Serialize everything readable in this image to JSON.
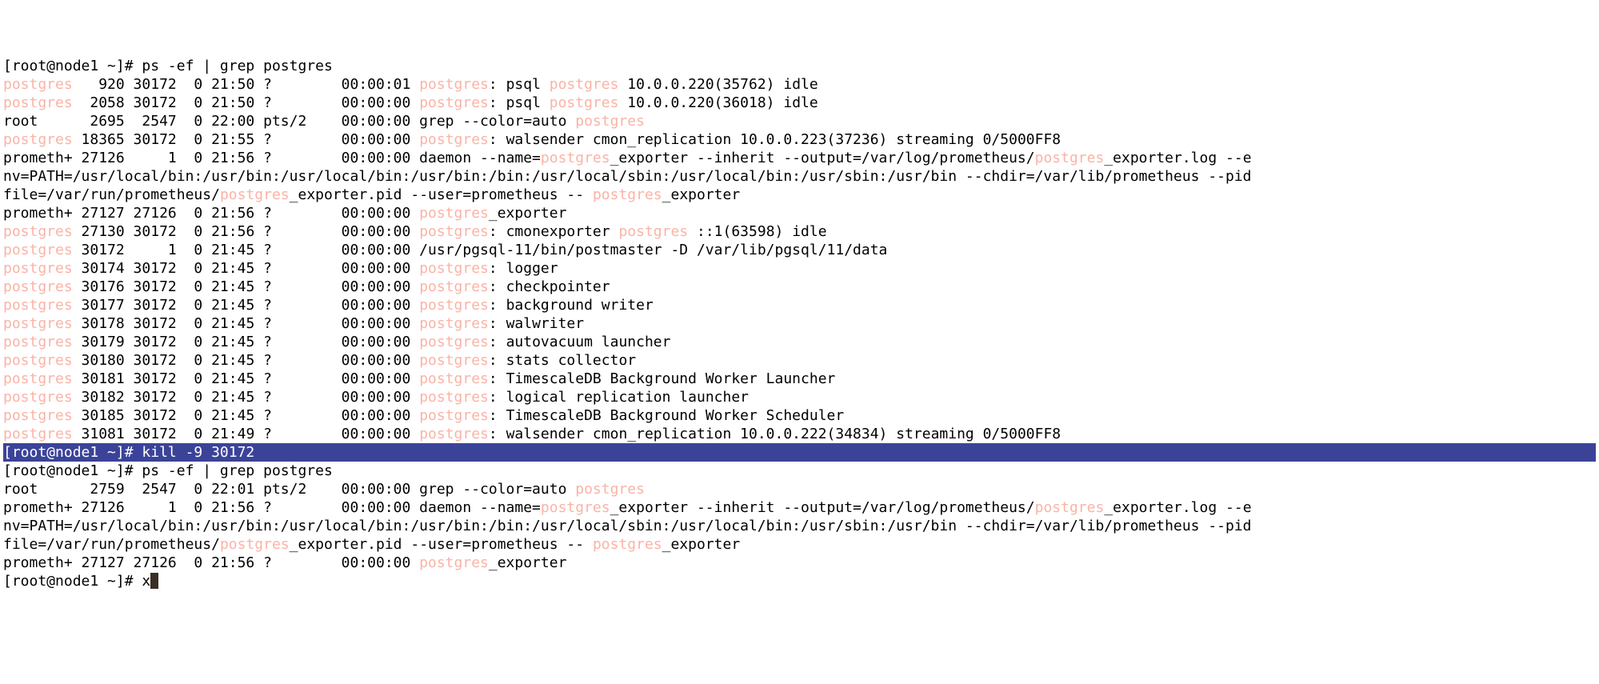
{
  "prompt1_prefix": "[root@node1 ~]# ",
  "cmd1": "ps -ef | grep postgres",
  "rows1": [
    {
      "user": "postgres",
      "hl_user": true,
      "pid": "  920",
      "ppid": "30172",
      "c": "0",
      "stime": "21:50",
      "tty": "?    ",
      "time": "00:00:01",
      "cmd": [
        {
          "t": "postgres",
          "hl": true
        },
        {
          "t": ": psql "
        },
        {
          "t": "postgres",
          "hl": true
        },
        {
          "t": " 10.0.0.220(35762) idle"
        }
      ]
    },
    {
      "user": "postgres",
      "hl_user": true,
      "pid": " 2058",
      "ppid": "30172",
      "c": "0",
      "stime": "21:50",
      "tty": "?    ",
      "time": "00:00:00",
      "cmd": [
        {
          "t": "postgres",
          "hl": true
        },
        {
          "t": ": psql "
        },
        {
          "t": "postgres",
          "hl": true
        },
        {
          "t": " 10.0.0.220(36018) idle"
        }
      ]
    },
    {
      "user": "root    ",
      "hl_user": false,
      "pid": " 2695",
      "ppid": " 2547",
      "c": "0",
      "stime": "22:00",
      "tty": "pts/2",
      "time": "00:00:00",
      "cmd": [
        {
          "t": "grep --color=auto "
        },
        {
          "t": "postgres",
          "hl": true
        }
      ]
    },
    {
      "user": "postgres",
      "hl_user": true,
      "pid": "18365",
      "ppid": "30172",
      "c": "0",
      "stime": "21:55",
      "tty": "?    ",
      "time": "00:00:00",
      "cmd": [
        {
          "t": "postgres",
          "hl": true
        },
        {
          "t": ": walsender cmon_replication 10.0.0.223(37236) streaming 0/5000FF8"
        }
      ]
    }
  ],
  "daemon_line1_pre": "prometh+ 27126     1  0 21:56 ?        00:00:00 daemon --name=",
  "daemon_hl1": "postgres",
  "daemon_line1_mid": "_exporter --inherit --output=/var/log/prometheus/",
  "daemon_hl2": "postgres",
  "daemon_line1_post": "_exporter.log --e",
  "daemon_line2": "nv=PATH=/usr/local/bin:/usr/bin:/usr/local/bin:/usr/bin:/bin:/usr/local/sbin:/usr/local/bin:/usr/sbin:/usr/bin --chdir=/var/lib/prometheus --pid",
  "daemon_line3_pre": "file=/var/run/prometheus/",
  "daemon_hl3": "postgres",
  "daemon_line3_mid": "_exporter.pid --user=prometheus -- ",
  "daemon_hl4": "postgres",
  "daemon_line3_post": "_exporter",
  "rows1b": [
    {
      "user": "prometh+",
      "hl_user": false,
      "pid": "27127",
      "ppid": "27126",
      "c": "0",
      "stime": "21:56",
      "tty": "?    ",
      "time": "00:00:00",
      "cmd": [
        {
          "t": "postgres",
          "hl": true
        },
        {
          "t": "_exporter"
        }
      ]
    },
    {
      "user": "postgres",
      "hl_user": true,
      "pid": "27130",
      "ppid": "30172",
      "c": "0",
      "stime": "21:56",
      "tty": "?    ",
      "time": "00:00:00",
      "cmd": [
        {
          "t": "postgres",
          "hl": true
        },
        {
          "t": ": cmonexporter "
        },
        {
          "t": "postgres",
          "hl": true
        },
        {
          "t": " ::1(63598) idle"
        }
      ]
    },
    {
      "user": "postgres",
      "hl_user": true,
      "pid": "30172",
      "ppid": "    1",
      "c": "0",
      "stime": "21:45",
      "tty": "?    ",
      "time": "00:00:00",
      "cmd": [
        {
          "t": "/usr/pgsql-11/bin/postmaster -D /var/lib/pgsql/11/data"
        }
      ]
    },
    {
      "user": "postgres",
      "hl_user": true,
      "pid": "30174",
      "ppid": "30172",
      "c": "0",
      "stime": "21:45",
      "tty": "?    ",
      "time": "00:00:00",
      "cmd": [
        {
          "t": "postgres",
          "hl": true
        },
        {
          "t": ": logger"
        }
      ]
    },
    {
      "user": "postgres",
      "hl_user": true,
      "pid": "30176",
      "ppid": "30172",
      "c": "0",
      "stime": "21:45",
      "tty": "?    ",
      "time": "00:00:00",
      "cmd": [
        {
          "t": "postgres",
          "hl": true
        },
        {
          "t": ": checkpointer"
        }
      ]
    },
    {
      "user": "postgres",
      "hl_user": true,
      "pid": "30177",
      "ppid": "30172",
      "c": "0",
      "stime": "21:45",
      "tty": "?    ",
      "time": "00:00:00",
      "cmd": [
        {
          "t": "postgres",
          "hl": true
        },
        {
          "t": ": background writer"
        }
      ]
    },
    {
      "user": "postgres",
      "hl_user": true,
      "pid": "30178",
      "ppid": "30172",
      "c": "0",
      "stime": "21:45",
      "tty": "?    ",
      "time": "00:00:00",
      "cmd": [
        {
          "t": "postgres",
          "hl": true
        },
        {
          "t": ": walwriter"
        }
      ]
    },
    {
      "user": "postgres",
      "hl_user": true,
      "pid": "30179",
      "ppid": "30172",
      "c": "0",
      "stime": "21:45",
      "tty": "?    ",
      "time": "00:00:00",
      "cmd": [
        {
          "t": "postgres",
          "hl": true
        },
        {
          "t": ": autovacuum launcher"
        }
      ]
    },
    {
      "user": "postgres",
      "hl_user": true,
      "pid": "30180",
      "ppid": "30172",
      "c": "0",
      "stime": "21:45",
      "tty": "?    ",
      "time": "00:00:00",
      "cmd": [
        {
          "t": "postgres",
          "hl": true
        },
        {
          "t": ": stats collector"
        }
      ]
    },
    {
      "user": "postgres",
      "hl_user": true,
      "pid": "30181",
      "ppid": "30172",
      "c": "0",
      "stime": "21:45",
      "tty": "?    ",
      "time": "00:00:00",
      "cmd": [
        {
          "t": "postgres",
          "hl": true
        },
        {
          "t": ": TimescaleDB Background Worker Launcher"
        }
      ]
    },
    {
      "user": "postgres",
      "hl_user": true,
      "pid": "30182",
      "ppid": "30172",
      "c": "0",
      "stime": "21:45",
      "tty": "?    ",
      "time": "00:00:00",
      "cmd": [
        {
          "t": "postgres",
          "hl": true
        },
        {
          "t": ": logical replication launcher"
        }
      ]
    },
    {
      "user": "postgres",
      "hl_user": true,
      "pid": "30185",
      "ppid": "30172",
      "c": "0",
      "stime": "21:45",
      "tty": "?    ",
      "time": "00:00:00",
      "cmd": [
        {
          "t": "postgres",
          "hl": true
        },
        {
          "t": ": TimescaleDB Background Worker Scheduler"
        }
      ]
    },
    {
      "user": "postgres",
      "hl_user": true,
      "pid": "31081",
      "ppid": "30172",
      "c": "0",
      "stime": "21:49",
      "tty": "?    ",
      "time": "00:00:00",
      "cmd": [
        {
          "t": "postgres",
          "hl": true
        },
        {
          "t": ": walsender cmon_replication 10.0.0.222(34834) streaming 0/5000FF8"
        }
      ]
    }
  ],
  "prompt2_prefix": "[root@node1 ~]# ",
  "cmd2": "kill -9 30172",
  "prompt3_prefix": "[root@node1 ~]# ",
  "cmd3": "ps -ef | grep postgres",
  "rows2": [
    {
      "user": "root    ",
      "hl_user": false,
      "pid": " 2759",
      "ppid": " 2547",
      "c": "0",
      "stime": "22:01",
      "tty": "pts/2",
      "time": "00:00:00",
      "cmd": [
        {
          "t": "grep --color=auto "
        },
        {
          "t": "postgres",
          "hl": true
        }
      ]
    }
  ],
  "rows2b": [
    {
      "user": "prometh+",
      "hl_user": false,
      "pid": "27127",
      "ppid": "27126",
      "c": "0",
      "stime": "21:56",
      "tty": "?    ",
      "time": "00:00:00",
      "cmd": [
        {
          "t": "postgres",
          "hl": true
        },
        {
          "t": "_exporter"
        }
      ]
    }
  ],
  "prompt4_prefix": "[root@node1 ~]# ",
  "cmd4": "x"
}
